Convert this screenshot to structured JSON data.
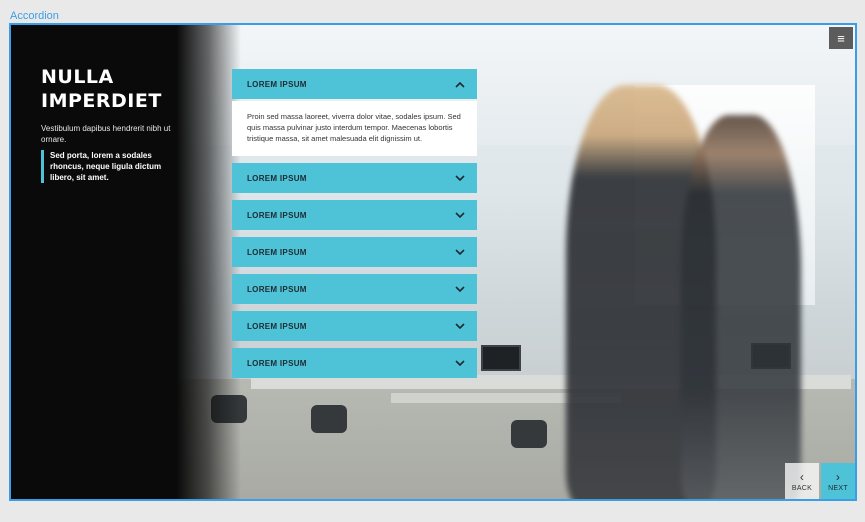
{
  "top_label": "Accordion",
  "left": {
    "title": "NULLA IMPERDIET",
    "description": "Vestibulum dapibus hendrerit nibh ut ornare.",
    "quote": "Sed porta, lorem a sodales rhoncus, neque ligula dictum libero, sit amet."
  },
  "menu": {
    "icon": "hamburger-icon",
    "glyph": "≡"
  },
  "accordion": {
    "items": [
      {
        "title": "LOREM IPSUM",
        "expanded": true,
        "body": "Proin sed massa laoreet, viverra dolor vitae, sodales ipsum. Sed quis massa pulvinar justo interdum tempor. Maecenas lobortis tristique massa, sit amet malesuada elit dignissim ut."
      },
      {
        "title": "LOREM IPSUM",
        "expanded": false
      },
      {
        "title": "LOREM IPSUM",
        "expanded": false
      },
      {
        "title": "LOREM IPSUM",
        "expanded": false
      },
      {
        "title": "LOREM IPSUM",
        "expanded": false
      },
      {
        "title": "LOREM IPSUM",
        "expanded": false
      },
      {
        "title": "LOREM IPSUM",
        "expanded": false
      }
    ]
  },
  "nav": {
    "back_label": "BACK",
    "next_label": "NEXT",
    "back_glyph": "‹",
    "next_glyph": "›"
  },
  "colors": {
    "accent": "#4ec3d8",
    "frame": "#3a9ee6",
    "panel": "#0a0a0a"
  }
}
